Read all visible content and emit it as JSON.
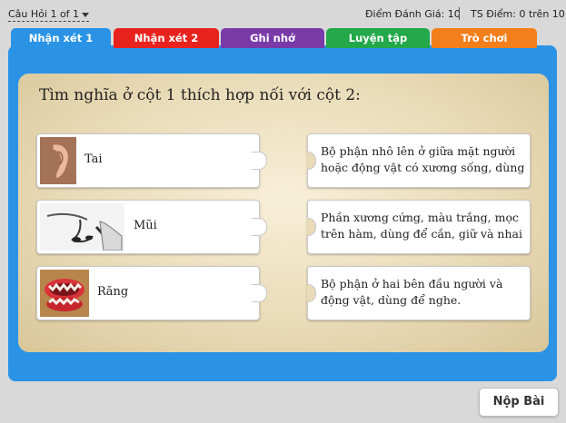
{
  "header": {
    "question_nav": "Câu Hỏi 1 of 1",
    "score_label": "Điểm Đánh Giá: 10",
    "total_label": "TS Điểm: 0 trên 10"
  },
  "tabs": [
    {
      "label": "Nhận xét 1",
      "color": "#2a93e6"
    },
    {
      "label": "Nhận xét 2",
      "color": "#e8231e"
    },
    {
      "label": "Ghi nhớ",
      "color": "#7a3aa8"
    },
    {
      "label": "Luyện tập",
      "color": "#23a84a"
    },
    {
      "label": "Trò chơi",
      "color": "#f27f1b"
    }
  ],
  "question": "Tìm nghĩa ở cột 1 thích hợp nối với cột 2:",
  "left_items": [
    {
      "label": "Tai",
      "image": "ear-image"
    },
    {
      "label": "Mũi",
      "image": "nose-drawing-image"
    },
    {
      "label": "Răng",
      "image": "teeth-model-image"
    }
  ],
  "right_items": [
    {
      "text": "Bộ phận nhô lên ở giữa mặt người hoặc động vật có xương sống, dùng"
    },
    {
      "text": "Phần xương cứng, màu trắng, mọc trên hàm, dùng để cắn, giữ và nhai"
    },
    {
      "text": "Bộ phận ở hai bên đầu người và động vật, dùng để nghe."
    }
  ],
  "footer": {
    "submit_label": "Nộp Bài"
  }
}
